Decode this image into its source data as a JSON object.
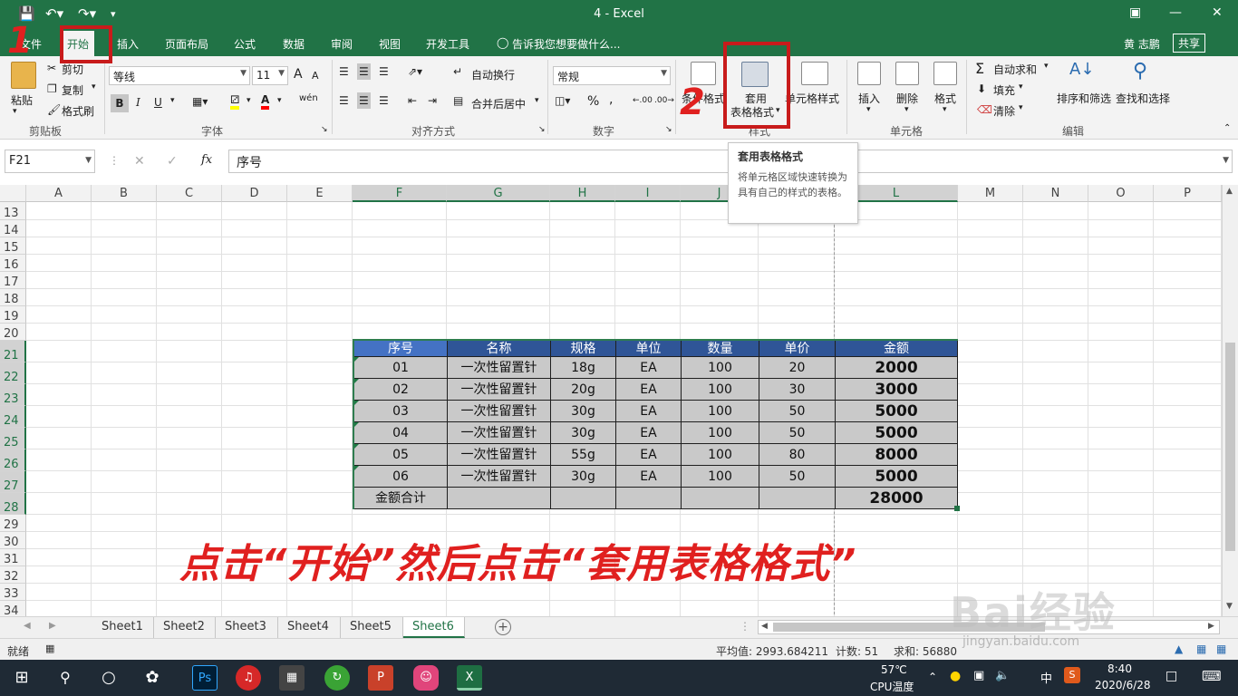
{
  "title_bar": {
    "title": "4 - Excel",
    "user": "黄 志鹏",
    "share_label": "共享"
  },
  "tabs": [
    {
      "label": "文件"
    },
    {
      "label": "开始"
    },
    {
      "label": "插入"
    },
    {
      "label": "页面布局"
    },
    {
      "label": "公式"
    },
    {
      "label": "数据"
    },
    {
      "label": "审阅"
    },
    {
      "label": "视图"
    },
    {
      "label": "开发工具"
    }
  ],
  "tell_me": "告诉我您想要做什么...",
  "ribbon": {
    "clipboard": {
      "paste": "粘贴",
      "cut": "剪切",
      "copy": "复制",
      "format_painter": "格式刷",
      "label": "剪贴板"
    },
    "font": {
      "font_name": "等线",
      "font_size": "11",
      "grow": "A",
      "shrink": "A",
      "bold": "B",
      "italic": "I",
      "underline": "U",
      "wen": "wén",
      "label": "字体"
    },
    "alignment": {
      "wrap": "自动换行",
      "merge": "合并后居中",
      "label": "对齐方式"
    },
    "number": {
      "format": "常规",
      "percent": "%",
      "comma": ",",
      "label": "数字"
    },
    "styles": {
      "conditional": "条件格式",
      "table_line1": "套用",
      "table_line2": "表格格式",
      "cell_styles": "单元格样式",
      "label": "样式"
    },
    "cells": {
      "insert": "插入",
      "delete": "删除",
      "format": "格式",
      "label": "单元格"
    },
    "editing": {
      "autosum": "自动求和",
      "fill": "填充",
      "clear": "清除",
      "sort": "排序和筛选",
      "find": "查找和选择",
      "label": "编辑"
    }
  },
  "formula_bar": {
    "name_box": "F21",
    "fx": "fx",
    "content": "序号"
  },
  "tooltip": {
    "title": "套用表格格式",
    "body": "将单元格区域快速转换为具有自己的样式的表格。"
  },
  "columns": [
    "A",
    "B",
    "C",
    "D",
    "E",
    "F",
    "G",
    "H",
    "I",
    "J",
    "K",
    "L",
    "M",
    "N",
    "O",
    "P"
  ],
  "rows": [
    "13",
    "14",
    "15",
    "16",
    "17",
    "18",
    "19",
    "20",
    "21",
    "22",
    "23",
    "24",
    "25",
    "26",
    "27",
    "28",
    "29",
    "30",
    "31",
    "32",
    "33",
    "34"
  ],
  "table": {
    "headers": [
      "序号",
      "名称",
      "规格",
      "单位",
      "数量",
      "单价",
      "金额"
    ],
    "rows": [
      [
        "01",
        "一次性留置针",
        "18g",
        "EA",
        "100",
        "20",
        "2000"
      ],
      [
        "02",
        "一次性留置针",
        "20g",
        "EA",
        "100",
        "30",
        "3000"
      ],
      [
        "03",
        "一次性留置针",
        "30g",
        "EA",
        "100",
        "50",
        "5000"
      ],
      [
        "04",
        "一次性留置针",
        "30g",
        "EA",
        "100",
        "50",
        "5000"
      ],
      [
        "05",
        "一次性留置针",
        "55g",
        "EA",
        "100",
        "80",
        "8000"
      ],
      [
        "06",
        "一次性留置针",
        "30g",
        "EA",
        "100",
        "50",
        "5000"
      ]
    ],
    "total_label": "金额合计",
    "total_value": "28000"
  },
  "annotation": "点击“开始”然后点击“套用表格格式”",
  "step_numbers": [
    "1",
    "2"
  ],
  "sheets": [
    "Sheet1",
    "Sheet2",
    "Sheet3",
    "Sheet4",
    "Sheet5",
    "Sheet6"
  ],
  "status": {
    "ready": "就绪",
    "average": "平均值: 2993.684211",
    "count": "计数: 51",
    "sum": "求和: 56880"
  },
  "taskbar": {
    "temp": "57℃",
    "temp_label": "CPU温度",
    "time": "8:40",
    "date": "2020/6/28",
    "lang": "中",
    "ps_label": "Ps",
    "excel_label": "X"
  },
  "watermark": {
    "logo": "Bai经验",
    "url": "jingyan.baidu.com"
  },
  "colors": {
    "excel_green": "#217346",
    "header_blue": "#2f5597",
    "annotation_red": "#e0201f"
  }
}
